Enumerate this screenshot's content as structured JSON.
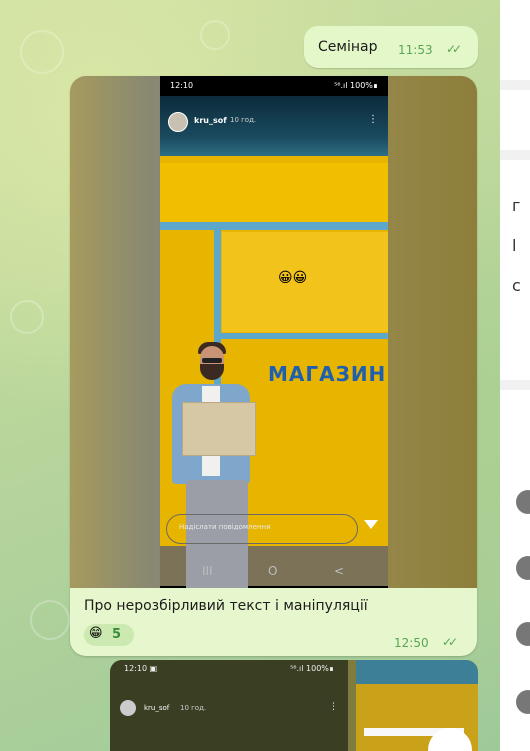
{
  "messages": {
    "first": {
      "text": "Семінар",
      "time": "11:53"
    },
    "story": {
      "status_time": "12:10",
      "status_right": "⁵⁶.ıl 100%∎",
      "username": "kru_sof",
      "ago": "10 год.",
      "sign_text": "МАГАЗИН",
      "sticker": "😀😀",
      "reply_placeholder": "Надіслати повідомлення",
      "nav": [
        "III",
        "O",
        "<"
      ]
    },
    "caption": {
      "text": "Про нерозбірливий текст і маніпуляції",
      "reaction_emoji": "😁",
      "reaction_count": "5",
      "time": "12:50"
    },
    "next_media": {
      "status_time": "12:10 ▣",
      "status_right": "⁵⁶.ıl 100%∎",
      "username": "kru_sof",
      "ago": "10 год."
    }
  },
  "right_panel": {
    "fragments": [
      "г",
      "l",
      "с"
    ]
  },
  "colors": {
    "outgoing_bubble": "#e3f7c8",
    "time_green": "#5aa654",
    "shop_blue": "#1e5fb0"
  }
}
